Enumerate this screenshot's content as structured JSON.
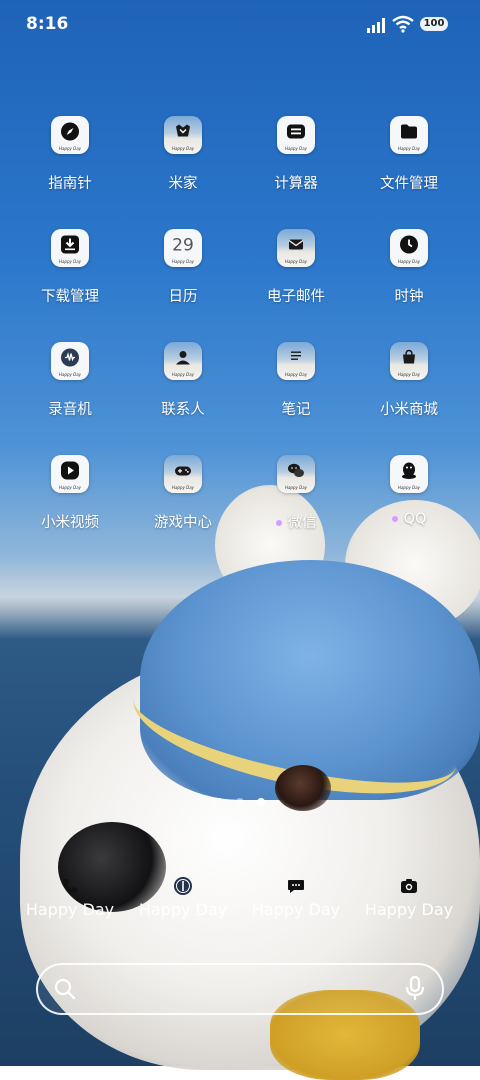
{
  "status_bar": {
    "time": "8:16",
    "battery": "100"
  },
  "apps": [
    {
      "name": "compass",
      "label": "指南针",
      "icon": "compass-icon",
      "style": "plain"
    },
    {
      "name": "mi-home",
      "label": "米家",
      "icon": "mi-home-icon",
      "style": "photo"
    },
    {
      "name": "calculator",
      "label": "计算器",
      "icon": "calculator-icon",
      "style": "plain"
    },
    {
      "name": "file-manager",
      "label": "文件管理",
      "icon": "folder-icon",
      "style": "plain"
    },
    {
      "name": "downloads",
      "label": "下载管理",
      "icon": "download-icon",
      "style": "plain"
    },
    {
      "name": "calendar",
      "label": "日历",
      "icon": "calendar-icon",
      "style": "plain",
      "glyph": "29"
    },
    {
      "name": "email",
      "label": "电子邮件",
      "icon": "email-icon",
      "style": "photo"
    },
    {
      "name": "clock",
      "label": "时钟",
      "icon": "clock-icon",
      "style": "plain"
    },
    {
      "name": "recorder",
      "label": "录音机",
      "icon": "recorder-icon",
      "style": "plain"
    },
    {
      "name": "contacts",
      "label": "联系人",
      "icon": "contacts-icon",
      "style": "photo"
    },
    {
      "name": "notes",
      "label": "笔记",
      "icon": "notes-icon",
      "style": "photo"
    },
    {
      "name": "mi-store",
      "label": "小米商城",
      "icon": "mi-store-icon",
      "style": "photo"
    },
    {
      "name": "mi-video",
      "label": "小米视频",
      "icon": "video-play-icon",
      "style": "plain"
    },
    {
      "name": "game-center",
      "label": "游戏中心",
      "icon": "gamepad-icon",
      "style": "photo"
    },
    {
      "name": "wechat",
      "label": "微信",
      "icon": "wechat-icon",
      "style": "photo",
      "new_dot": true
    },
    {
      "name": "qq",
      "label": "QQ",
      "icon": "qq-penguin-icon",
      "style": "plain",
      "new_dot": true
    }
  ],
  "icon_caption": "Happy Day",
  "dock": [
    {
      "name": "phone",
      "icon": "phone-icon",
      "style": "photo"
    },
    {
      "name": "browser",
      "icon": "browser-icon",
      "style": "plain"
    },
    {
      "name": "messages",
      "icon": "messages-icon",
      "style": "photo"
    },
    {
      "name": "camera",
      "icon": "camera-icon",
      "style": "plain"
    }
  ],
  "colors": {
    "new_dot": "#d69cff",
    "label": "#ffffff"
  }
}
